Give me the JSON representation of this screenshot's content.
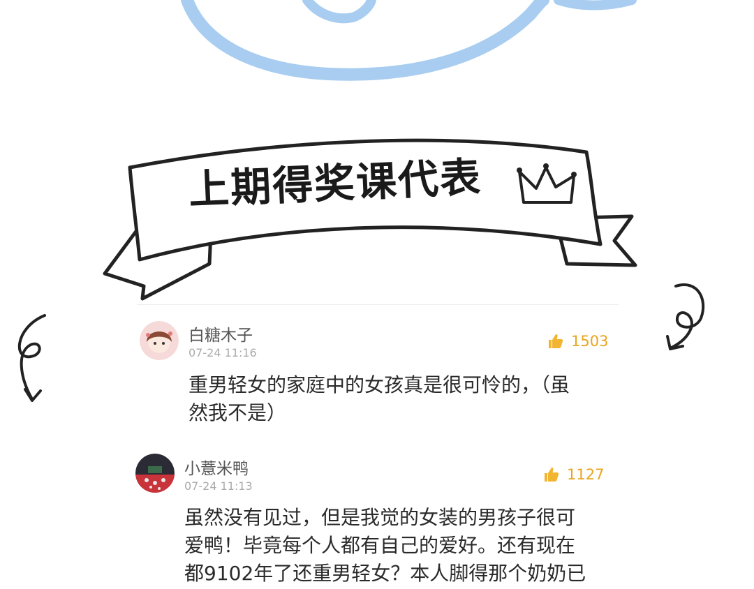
{
  "banner": {
    "title": "上期得奖课代表"
  },
  "comments": [
    {
      "username": "白糖木子",
      "timestamp": "07-24 11:16",
      "likes": "1503",
      "lines": [
        "重男轻女的家庭中的女孩真是很可怜的，（虽",
        "然我不是）"
      ]
    },
    {
      "username": "小薏米鸭",
      "timestamp": "07-24 11:13",
      "likes": "1127",
      "lines": [
        "虽然没有见过，但是我觉的女装的男孩子很可",
        "爱鸭！毕竟每个人都有自己的爱好。还有现在",
        "都9102年了还重男轻女？本人脚得那个奶奶已"
      ]
    }
  ],
  "colors": {
    "accent": "#f2b531",
    "decoration": "#a8cdf0",
    "ink": "#1a1a1a"
  },
  "icons": {
    "like": "thumbs-up-icon",
    "crown": "crown-icon"
  }
}
